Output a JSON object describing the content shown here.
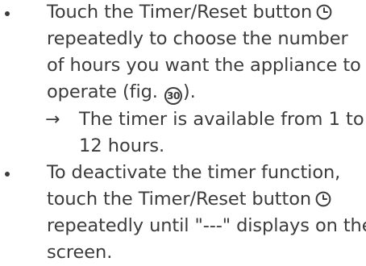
{
  "bullet_1": {
    "lines": [
      "Touch the Timer/Reset button",
      "repeatedly to choose the number",
      "of hours you want the appliance to",
      "operate (fig. ",
      ")."
    ],
    "fig_number": "30",
    "icon": "timer-clock-icon"
  },
  "result_1": {
    "arrow": "→",
    "lines": [
      "The timer is available from 1 to",
      "12 hours."
    ]
  },
  "bullet_2": {
    "lines": [
      "To deactivate the timer function,",
      "touch the Timer/Reset button",
      "repeatedly until \"---\" displays on the",
      "screen."
    ],
    "icon": "timer-clock-icon"
  },
  "colors": {
    "text": "#3c3c3c",
    "background": "#ffffff"
  }
}
